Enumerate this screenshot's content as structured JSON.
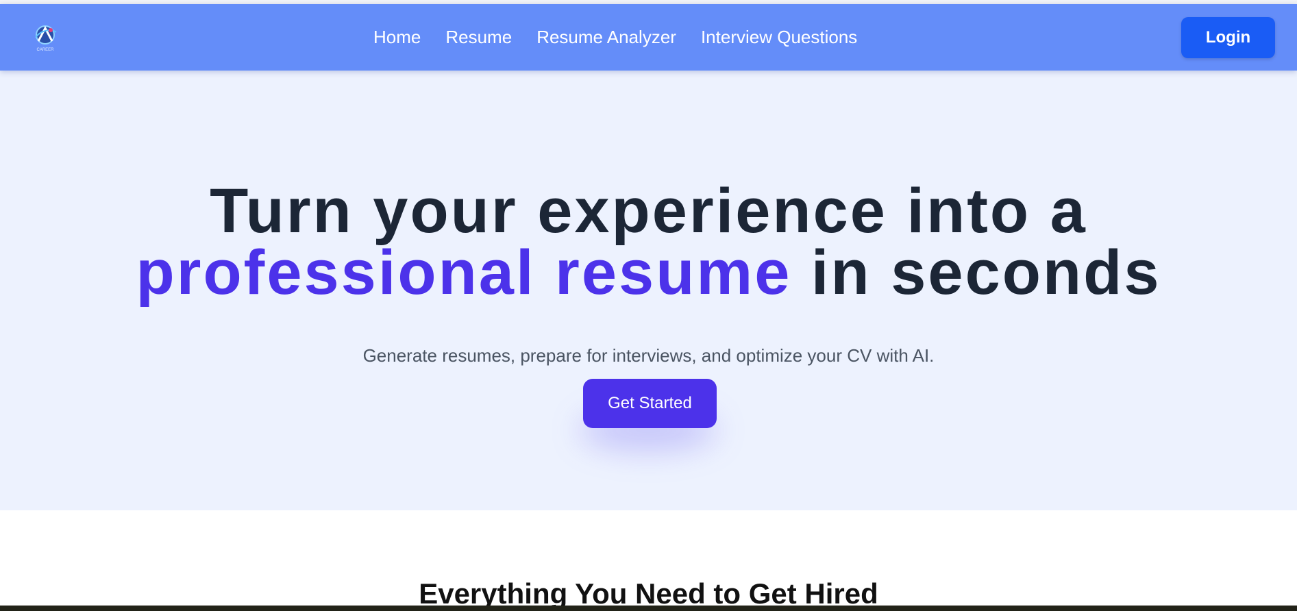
{
  "brand": {
    "logo_text": "CAREER",
    "logo_icon": "career-logo"
  },
  "nav": {
    "links": [
      {
        "label": "Home"
      },
      {
        "label": "Resume"
      },
      {
        "label": "Resume Analyzer"
      },
      {
        "label": "Interview Questions"
      }
    ],
    "login_label": "Login"
  },
  "hero": {
    "headline_line1": "Turn your experience into a",
    "headline_accent": "professional resume",
    "headline_line2_rest": " in seconds",
    "subtitle": "Generate resumes, prepare for interviews, and optimize your CV with AI.",
    "cta_label": "Get Started"
  },
  "features": {
    "title": "Everything You Need to Get Hired"
  },
  "colors": {
    "navbar": "#648df9",
    "login_button": "#1a5cf5",
    "accent": "#4c32ea",
    "hero_background": "#edf2fe",
    "headline_text": "#1c2636",
    "subtitle_text": "#4a5462"
  }
}
